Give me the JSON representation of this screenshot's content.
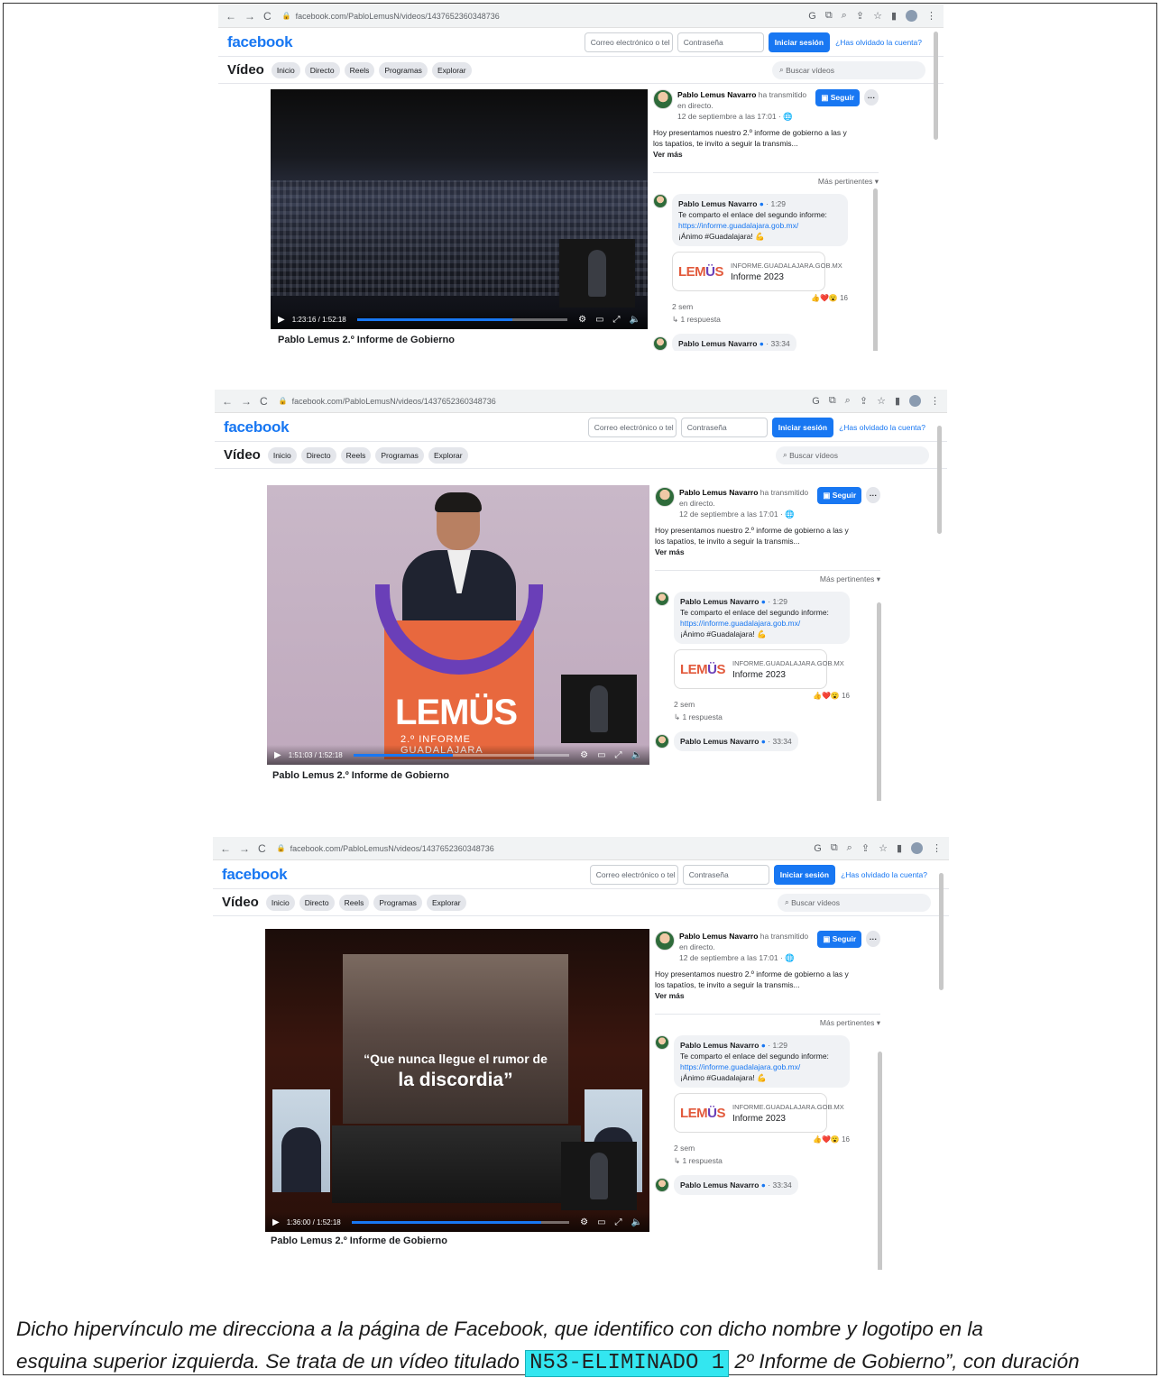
{
  "browser": {
    "url": "facebook.com/PabloLemusN/videos/1437652360348736",
    "nav_back": "←",
    "nav_forward": "→",
    "nav_reload": "C"
  },
  "facebook": {
    "logo": "facebook",
    "email_placeholder": "Correo electrónico o tel",
    "password_placeholder": "Contraseña",
    "login_label": "Iniciar sesión",
    "forgot_label": "¿Has olvidado la cuenta?",
    "section_title": "Vídeo",
    "tabs": [
      "Inicio",
      "Directo",
      "Reels",
      "Programas",
      "Explorar"
    ],
    "search_placeholder": "Buscar vídeos"
  },
  "post": {
    "author": "Pablo Lemus Navarro",
    "action": "ha transmitido en directo.",
    "date": "12 de septiembre a las 17:01 · ",
    "follow_label": "Seguir",
    "description": "Hoy presentamos nuestro 2.º informe de gobierno a las y los tapatíos, te invito a seguir la transmis...",
    "see_more": "Ver más",
    "sort_label": "Más pertinentes ▾",
    "video_title": "Pablo Lemus 2.º Informe de Gobierno"
  },
  "comment": {
    "author": "Pablo Lemus Navarro",
    "time": "· 1:29",
    "text": "Te comparto el enlace del segundo informe:",
    "link": "https://informe.guadalajara.gob.mx/",
    "cheer": "¡Ánimo #Guadalajara! 💪",
    "card_logo_a": "LEM",
    "card_logo_b": "Ü",
    "card_logo_c": "S",
    "card_domain": "INFORME.GUADALAJARA.GOB.MX",
    "card_title": "Informe 2023",
    "reaction_count": "16",
    "age": "2 sem",
    "replies": "1 respuesta",
    "next_time": "· 33:34"
  },
  "screenshots": [
    {
      "time": "1:23:16 / 1:52:18",
      "progress": 0.74
    },
    {
      "time": "1:51:03 / 1:52:18",
      "progress": 0.46
    },
    {
      "time": "1:36:00 / 1:52:18",
      "progress": 0.87
    }
  ],
  "scenes": {
    "podium_word": "LEMÜS",
    "podium_sub": "2.º INFORME GUADALAJARA",
    "quote_line1": "“Que nunca llegue el rumor de",
    "quote_line2": "la discordia”"
  },
  "caption": {
    "line1": "Dicho hipervínculo me direcciona a la página de Facebook, que identifico con dicho nombre y logotipo en la",
    "line2_start": "esquina superior izquierda. Se trata de un vídeo titulado ",
    "redaction": "N53-ELIMINADO 1",
    "line2_end": " 2º Informe de Gobierno”, con duración"
  }
}
